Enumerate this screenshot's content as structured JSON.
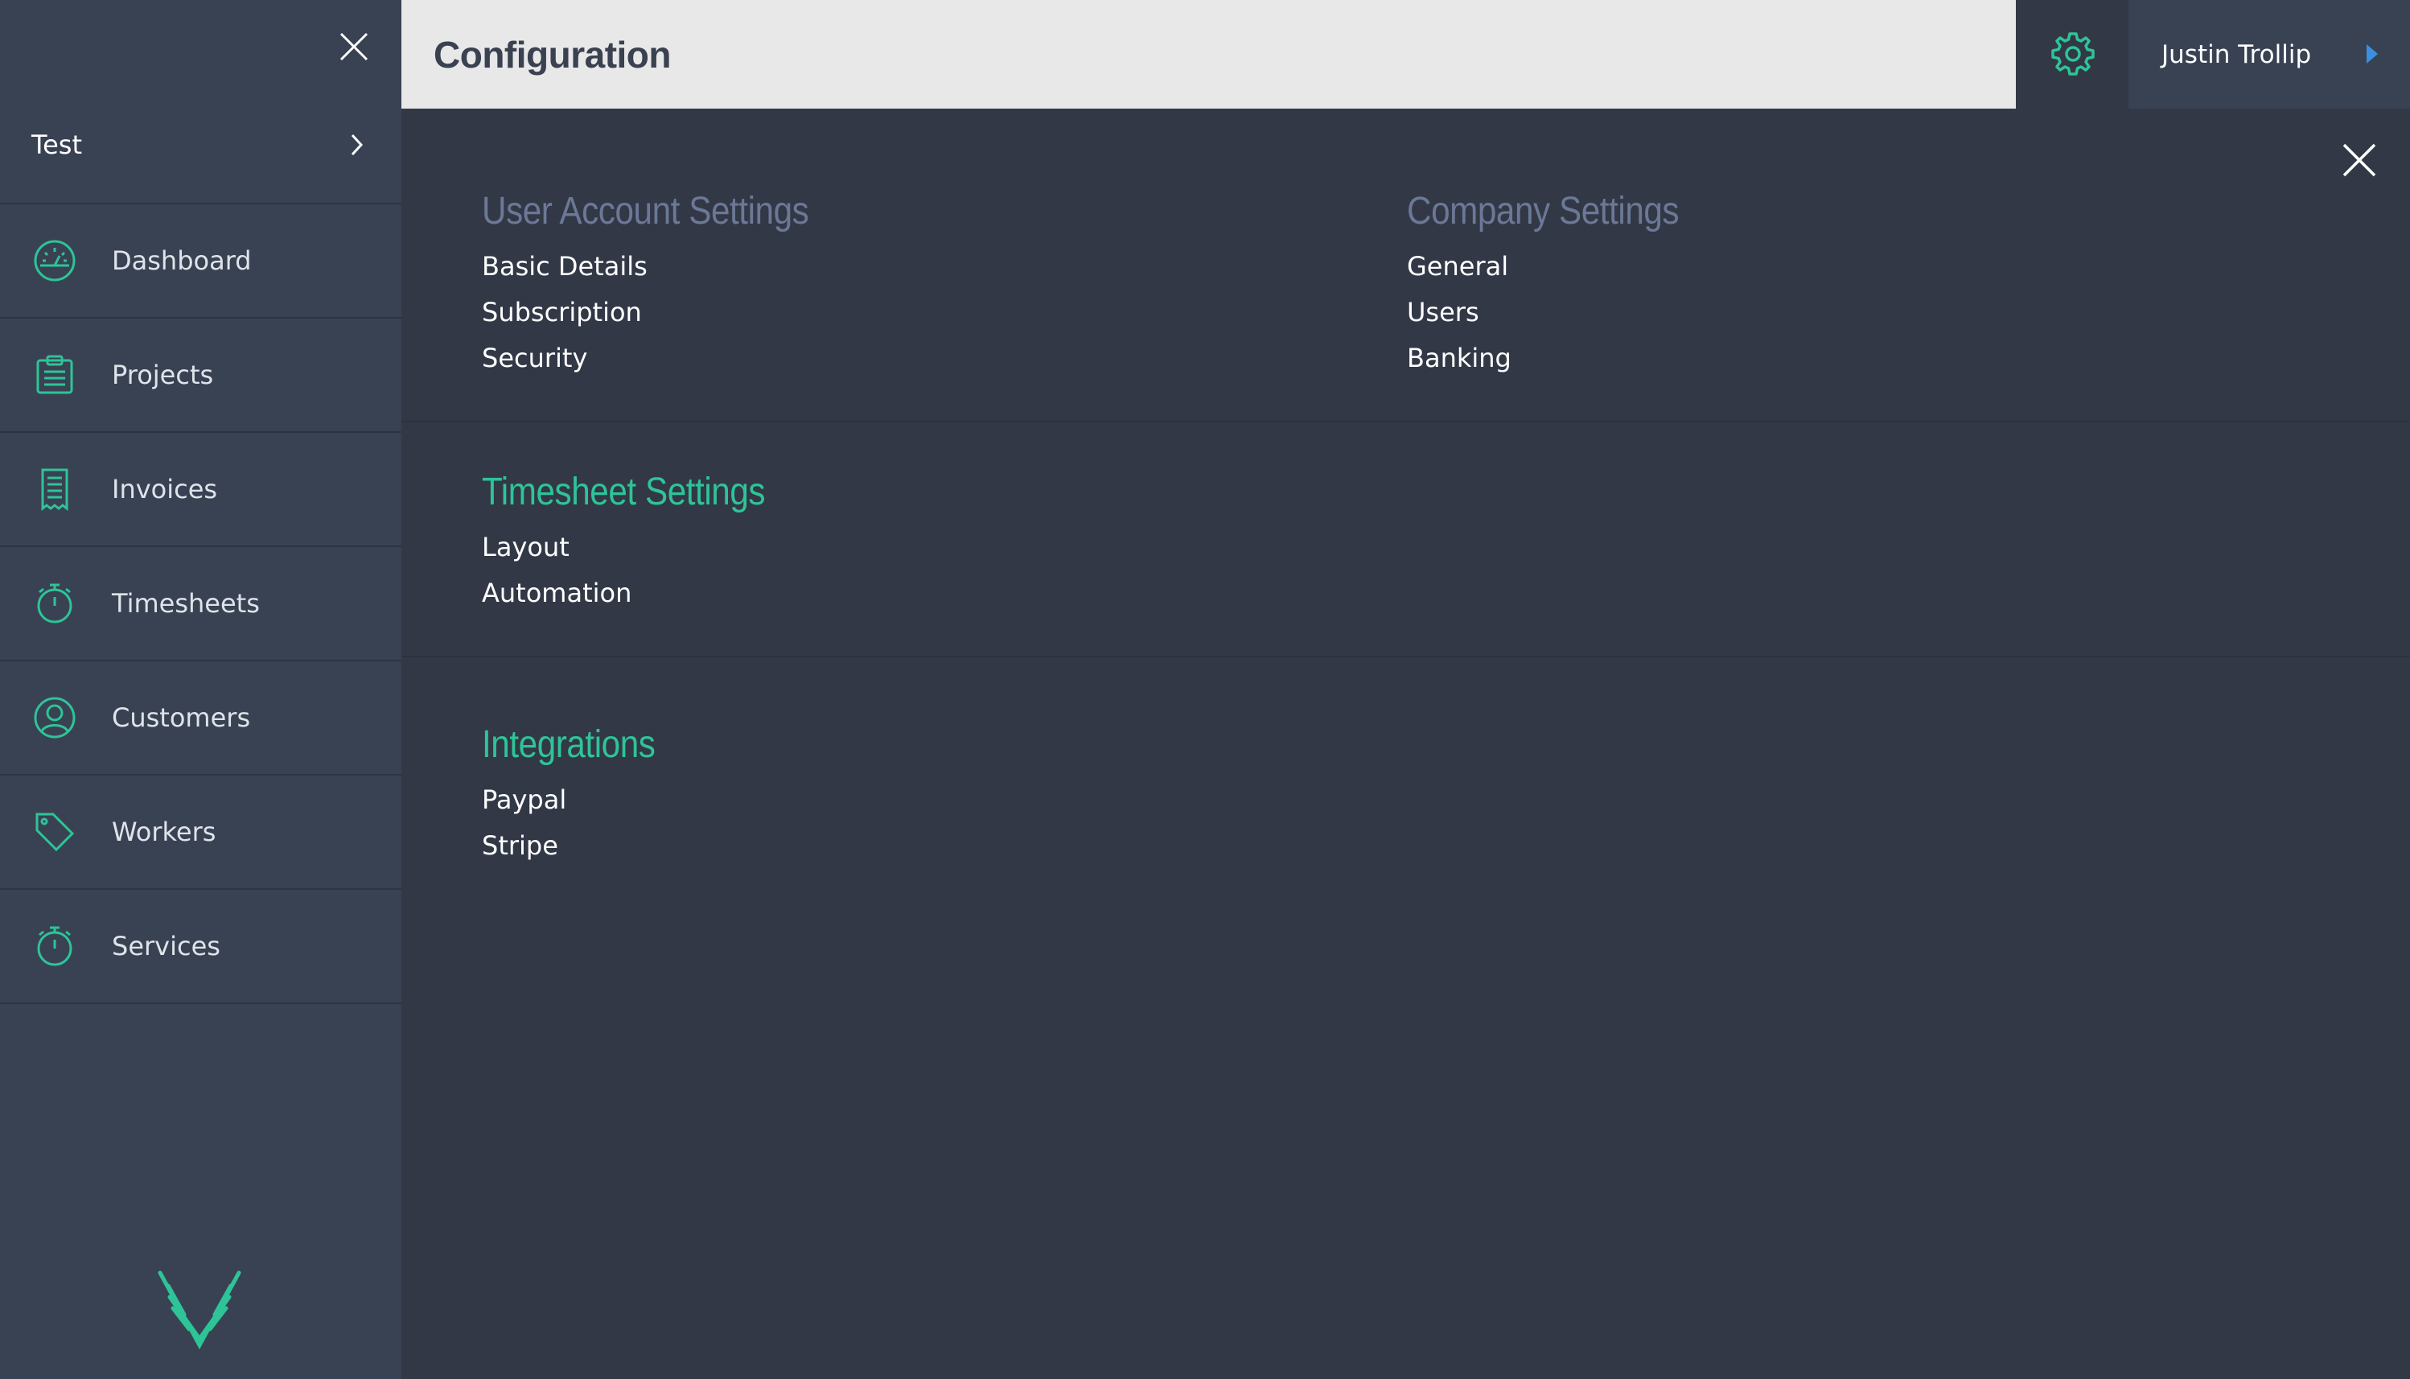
{
  "colors": {
    "accent": "#2ec497",
    "sidebar_bg": "#394253",
    "main_bg": "#323846",
    "header_bg": "#e8e8e8",
    "muted_title": "#6b7896",
    "caret_blue": "#3b8fe0"
  },
  "header": {
    "title": "Configuration",
    "settings_icon": "gear-icon",
    "user_name": "Justin Trollip"
  },
  "sidebar": {
    "workspace": "Test",
    "items": [
      {
        "label": "Dashboard",
        "icon": "dashboard-gauge-icon"
      },
      {
        "label": "Projects",
        "icon": "clipboard-icon"
      },
      {
        "label": "Invoices",
        "icon": "receipt-icon"
      },
      {
        "label": "Timesheets",
        "icon": "stopwatch-icon"
      },
      {
        "label": "Customers",
        "icon": "user-circle-icon"
      },
      {
        "label": "Workers",
        "icon": "tag-icon"
      },
      {
        "label": "Services",
        "icon": "stopwatch-icon"
      }
    ]
  },
  "config": {
    "user_account": {
      "title": "User Account Settings",
      "links": [
        "Basic Details",
        "Subscription",
        "Security"
      ]
    },
    "company": {
      "title": "Company Settings",
      "links": [
        "General",
        "Users",
        "Banking"
      ]
    },
    "timesheet": {
      "title": "Timesheet Settings",
      "links": [
        "Layout",
        "Automation"
      ]
    },
    "integrations": {
      "title": "Integrations",
      "links": [
        "Paypal",
        "Stripe"
      ]
    }
  }
}
